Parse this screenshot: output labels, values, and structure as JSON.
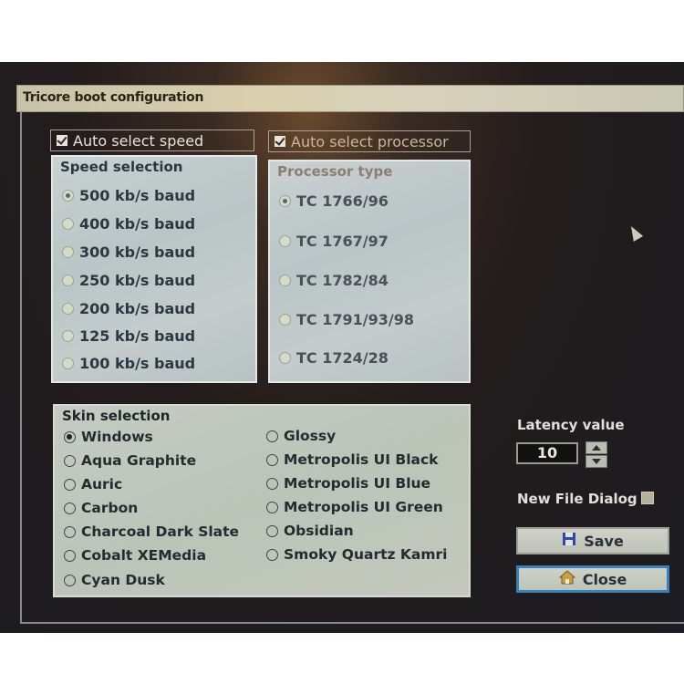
{
  "window": {
    "title": "Tricore boot configuration"
  },
  "auto_speed": {
    "label": "Auto select speed",
    "checked": true
  },
  "auto_processor": {
    "label": "Auto select processor",
    "checked": true
  },
  "speed": {
    "legend": "Speed selection",
    "options": [
      "500 kb/s baud",
      "400 kb/s baud",
      "300 kb/s baud",
      "250 kb/s baud",
      "200 kb/s baud",
      "125 kb/s baud",
      "100 kb/s baud"
    ],
    "selected": "500 kb/s baud"
  },
  "processor": {
    "legend": "Processor type",
    "options": [
      "TC 1766/96",
      "TC 1767/97",
      "TC 1782/84",
      "TC 1791/93/98",
      "TC 1724/28"
    ],
    "selected": "TC 1766/96"
  },
  "skin": {
    "legend": "Skin selection",
    "left": [
      "Windows",
      "Aqua Graphite",
      "Auric",
      "Carbon",
      "Charcoal Dark Slate",
      "Cobalt XEMedia",
      "Cyan Dusk"
    ],
    "right": [
      "Glossy",
      "Metropolis UI Black",
      "Metropolis UI Blue",
      "Metropolis UI Green",
      "Obsidian",
      "Smoky Quartz Kamri"
    ],
    "selected": "Windows"
  },
  "latency": {
    "label": "Latency value",
    "value": "10"
  },
  "new_file_dialog": {
    "label": "New File Dialog",
    "checked": false
  },
  "buttons": {
    "save": "Save",
    "close": "Close"
  },
  "colors": {
    "focus_border": "#3a7fb8",
    "save_icon": "#2f4aa0",
    "close_icon": "#c8a040"
  }
}
